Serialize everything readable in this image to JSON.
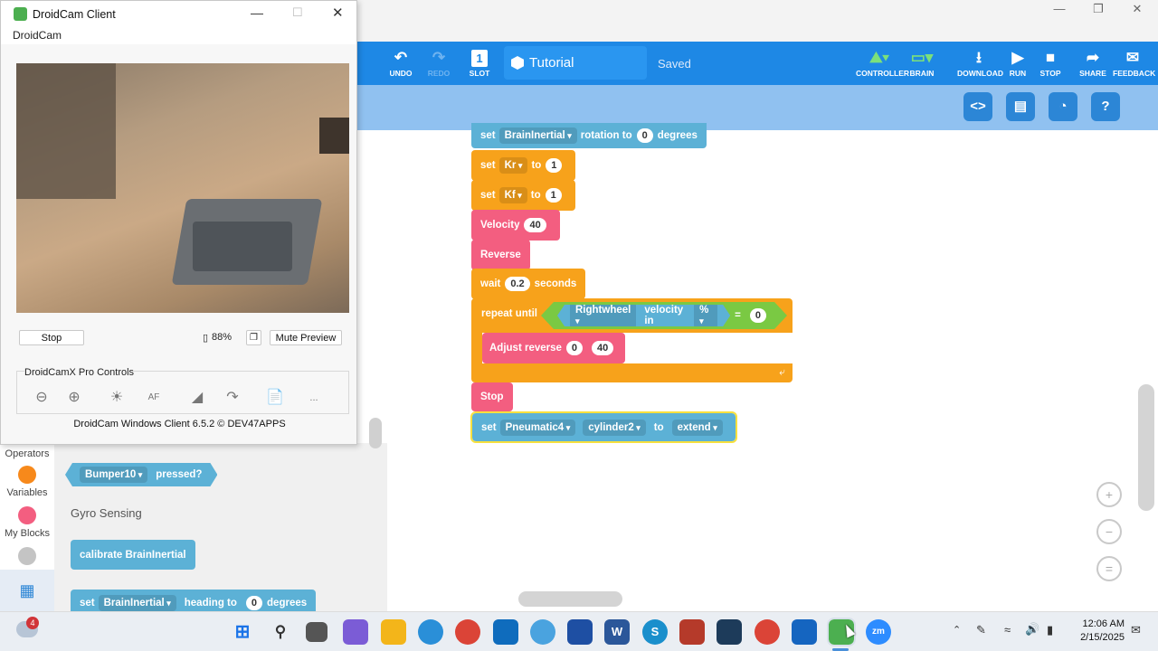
{
  "droidcam": {
    "title": "DroidCam Client",
    "menu": "DroidCam",
    "stop_label": "Stop",
    "battery": "88%",
    "mute_label": "Mute Preview",
    "pro_title": "DroidCamX Pro Controls",
    "af_label": "AF",
    "more_label": "...",
    "footer": "DroidCam Windows Client 6.5.2 © DEV47APPS"
  },
  "vex": {
    "toolbar": {
      "undo": "UNDO",
      "redo": "REDO",
      "slot_num": "1",
      "slot": "SLOT",
      "project_name": "Tutorial",
      "saved": "Saved",
      "controller": "CONTROLLER",
      "brain": "BRAIN",
      "download": "DOWNLOAD",
      "run": "RUN",
      "stop": "STOP",
      "share": "SHARE",
      "feedback": "FEEDBACK"
    },
    "blocks": {
      "b1": {
        "set": "set",
        "dev": "BrainInertial",
        "mid": "rotation to",
        "val": "0",
        "tail": "degrees"
      },
      "b2": {
        "set": "set",
        "var": "Kr",
        "to": "to",
        "val": "1"
      },
      "b3": {
        "set": "set",
        "var": "Kf",
        "to": "to",
        "val": "1"
      },
      "b4": {
        "label": "Velocity",
        "val": "40"
      },
      "b5": {
        "label": "Reverse"
      },
      "b6": {
        "label": "wait",
        "val": "0.2",
        "tail": "seconds"
      },
      "b7": {
        "label": "repeat until",
        "motor": "Rightwheel",
        "mid": "velocity in",
        "unit": "%",
        "op": "=",
        "val": "0"
      },
      "b8": {
        "label": "Adjust reverse",
        "v1": "0",
        "v2": "40"
      },
      "b9": {
        "label": "Stop"
      },
      "b10": {
        "set": "set",
        "dev": "Pneumatic4",
        "cyl": "cylinder2",
        "to": "to",
        "action": "extend"
      }
    },
    "categories": [
      "Operators",
      "Variables",
      "My Blocks"
    ],
    "flyout": {
      "bumper_dev": "Bumper10",
      "bumper_tail": "pressed?",
      "gyro_heading": "Gyro Sensing",
      "calibrate": "calibrate BrainInertial",
      "heading_set": "set",
      "heading_dev": "BrainInertial",
      "heading_mid": "heading to",
      "heading_val": "0",
      "heading_tail": "degrees"
    }
  },
  "taskbar": {
    "weather_badge": "4",
    "time": "12:06 AM",
    "date": "2/15/2025"
  },
  "colors": {
    "toolbar": "#1e88e5",
    "orange": "#f7a21b",
    "pink": "#f35e80",
    "blue": "#5cb1d6",
    "green": "#7ac943"
  }
}
